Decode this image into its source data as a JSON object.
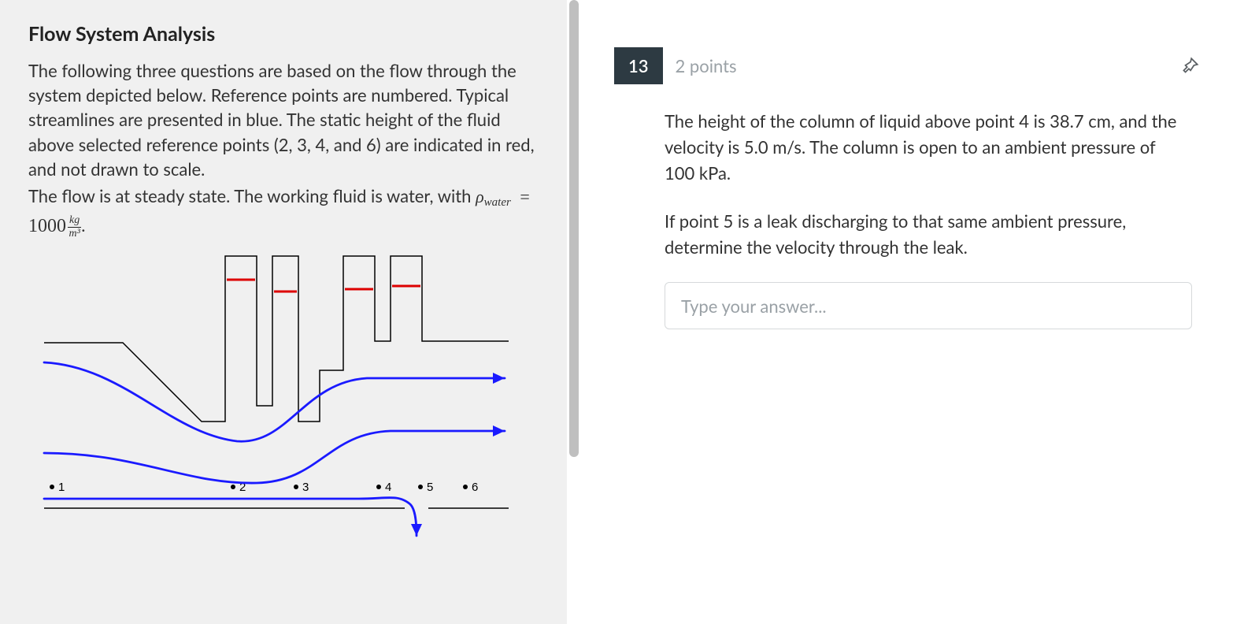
{
  "left": {
    "title": "Flow System Analysis",
    "para1": "The following three questions are based on the flow through the system depicted below. Reference points are numbered. Typical streamlines are presented in blue. The static height of the fluid above selected reference points (2, 3, 4, and 6) are indicated in red, and not drawn to scale.",
    "para2_prefix": "The flow is at steady state. The working fluid is water, with ",
    "rho": "ρ",
    "rho_sub": "water",
    "equals": " = ",
    "rho_val": "1000",
    "frac_top": "kg",
    "frac_bot": "m³",
    "period": ".",
    "points": {
      "p1": "1",
      "p2": "2",
      "p3": "3",
      "p4": "4",
      "p5": "5",
      "p6": "6"
    }
  },
  "right": {
    "number": "13",
    "points_label": "2 points",
    "text1": "The height of the column of liquid above point 4 is 38.7 cm, and the velocity is 5.0 m/s. The column is open to an ambient pressure of 100 kPa.",
    "text2": "If point 5 is a leak discharging to that same ambient pressure, determine the velocity through the leak.",
    "placeholder": "Type your answer..."
  }
}
